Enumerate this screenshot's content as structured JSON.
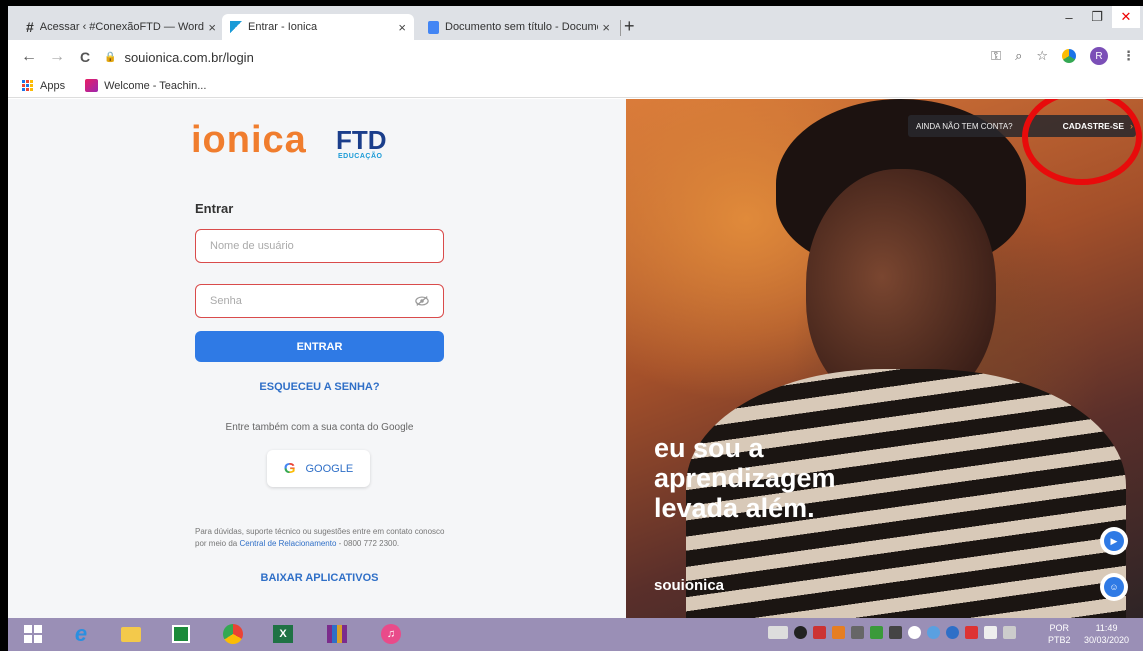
{
  "browser": {
    "tabs": [
      {
        "title": "Acessar ‹ #ConexãoFTD — Word",
        "close": "×"
      },
      {
        "title": "Entrar - Ionica",
        "close": "×"
      },
      {
        "title": "Documento sem título - Docume",
        "close": "×"
      }
    ],
    "new_tab": "+",
    "window_controls": {
      "minimize": "–",
      "maximize": "❐",
      "close": "✕"
    },
    "nav": {
      "back": "←",
      "forward": "→",
      "reload": "C"
    },
    "url": "souionica.com.br/login",
    "profile_initial": "R",
    "bookmarks": [
      {
        "label": "Apps"
      },
      {
        "label": "Welcome - Teachin..."
      }
    ]
  },
  "login": {
    "logo_ionica": "ionica",
    "logo_ftd": "FTD",
    "logo_ftd_sub": "EDUCAÇÃO",
    "heading": "Entrar",
    "username_placeholder": "Nome de usuário",
    "password_placeholder": "Senha",
    "submit_label": "ENTRAR",
    "forgot_label": "ESQUECEU A SENHA?",
    "google_hint": "Entre também com a sua conta do Google",
    "google_label": "GOOGLE",
    "support_text": "Para dúvidas, suporte técnico ou sugestões entre em contato conosco por meio da",
    "support_link": "Central de Relacionamento",
    "support_phone": " - 0800 772 2300.",
    "download_label": "BAIXAR APLICATIVOS"
  },
  "hero": {
    "cta_question": "AINDA NÃO TEM CONTA?",
    "cta_link": "CADASTRE-SE",
    "cta_chevron": "›",
    "tagline_line1": "eu sou a",
    "tagline_line2": "aprendizagem",
    "tagline_line3": "levada além.",
    "brand": "souionica",
    "play_glyph": "▶",
    "help_glyph": "☺"
  },
  "taskbar": {
    "language_line1": "POR",
    "language_line2": "PTB2",
    "time": "11:49",
    "date": "30/03/2020"
  },
  "colors": {
    "accent": "#2f7ae5",
    "brand_orange": "#f07d2e",
    "error_border": "#d94b4b",
    "highlight": "#e80b0b"
  }
}
